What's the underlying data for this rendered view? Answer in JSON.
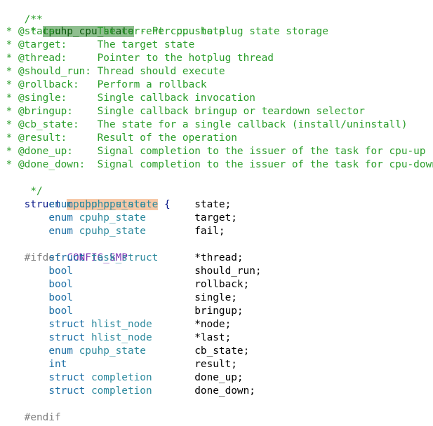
{
  "comment": {
    "open": "/**",
    "title_prefix": " * ",
    "title_name": "cpuhp_cpu_state",
    "title_rest": " - Per cpu hotplug state storage",
    "params": [
      {
        "prefix": " * ",
        "name": "@state:",
        "pad": "      ",
        "desc": "The current cpu state"
      },
      {
        "prefix": " * ",
        "name": "@target:",
        "pad": "     ",
        "desc": "The target state"
      },
      {
        "prefix": " * ",
        "name": "@thread:",
        "pad": "     ",
        "desc": "Pointer to the hotplug thread"
      },
      {
        "prefix": " * ",
        "name": "@should_run:",
        "pad": " ",
        "desc": "Thread should execute"
      },
      {
        "prefix": " * ",
        "name": "@rollback:",
        "pad": "   ",
        "desc": "Perform a rollback"
      },
      {
        "prefix": " * ",
        "name": "@single:",
        "pad": "     ",
        "desc": "Single callback invocation"
      },
      {
        "prefix": " * ",
        "name": "@bringup:",
        "pad": "    ",
        "desc": "Single callback bringup or teardown selector"
      },
      {
        "prefix": " * ",
        "name": "@cb_state:",
        "pad": "   ",
        "desc": "The state for a single callback (install/uninstall)"
      },
      {
        "prefix": " * ",
        "name": "@result:",
        "pad": "     ",
        "desc": "Result of the operation"
      },
      {
        "prefix": " * ",
        "name": "@done_up:",
        "pad": "    ",
        "desc": "Signal completion to the issuer of the task for cpu-up"
      },
      {
        "prefix": " * ",
        "name": "@done_down:",
        "pad": "  ",
        "desc": "Signal completion to the issuer of the task for cpu-down"
      }
    ],
    "close": " */"
  },
  "struct_head": {
    "keyword": "struct",
    "name": "cpuhp_cpu_state",
    "brace": "{"
  },
  "fields_a": [
    {
      "kw": "enum",
      "type": "cpuhp_state",
      "name": "state;"
    },
    {
      "kw": "enum",
      "type": "cpuhp_state",
      "name": "target;"
    },
    {
      "kw": "enum",
      "type": "cpuhp_state",
      "name": "fail;"
    }
  ],
  "ifdef": {
    "directive": "#ifdef",
    "macro": "CONFIG_SMP"
  },
  "fields_b": [
    {
      "kw": "struct",
      "type": "task_struct",
      "name": "*thread;"
    },
    {
      "kw": "bool",
      "type": "",
      "name": "should_run;"
    },
    {
      "kw": "bool",
      "type": "",
      "name": "rollback;"
    },
    {
      "kw": "bool",
      "type": "",
      "name": "single;"
    },
    {
      "kw": "bool",
      "type": "",
      "name": "bringup;"
    },
    {
      "kw": "struct",
      "type": "hlist_node",
      "name": "*node;"
    },
    {
      "kw": "struct",
      "type": "hlist_node",
      "name": "*last;"
    },
    {
      "kw": "enum",
      "type": "cpuhp_state",
      "name": "cb_state;"
    },
    {
      "kw": "int",
      "type": "",
      "name": "result;"
    },
    {
      "kw": "struct",
      "type": "completion",
      "name": "done_up;"
    },
    {
      "kw": "struct",
      "type": "completion",
      "name": "done_down;"
    }
  ],
  "endif": "#endif",
  "close": "};"
}
